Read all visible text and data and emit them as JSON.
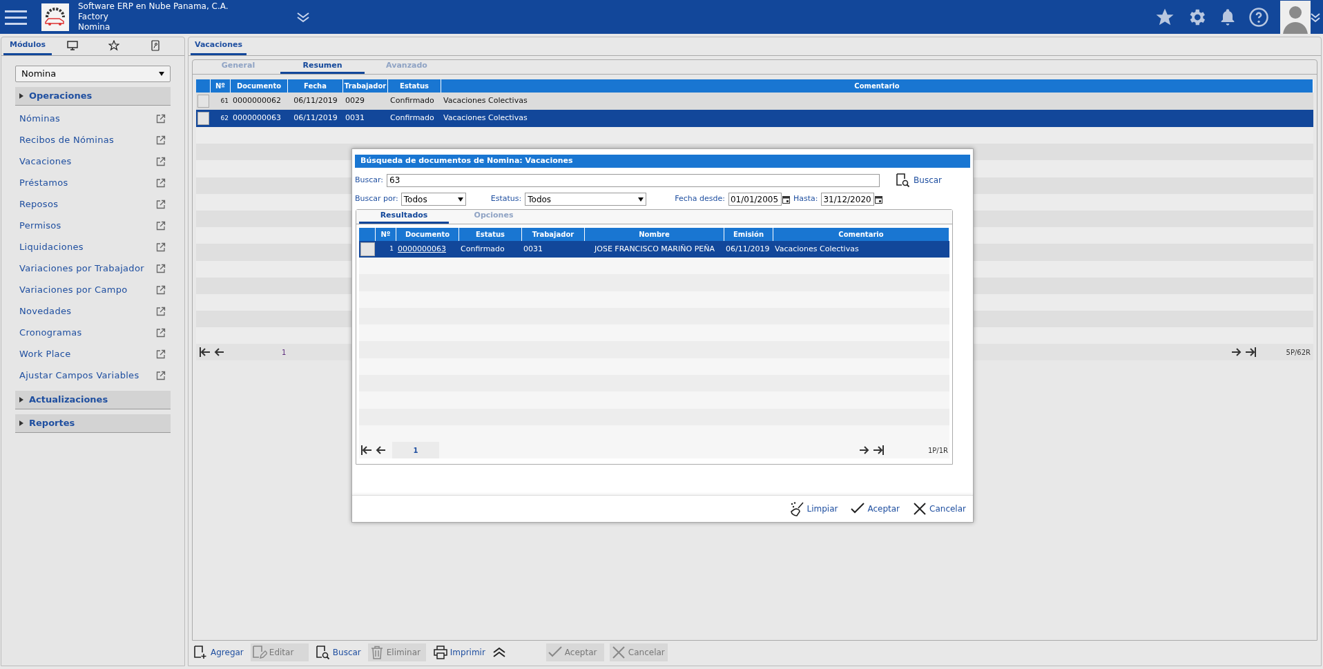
{
  "header": {
    "company": "Software ERP en Nube Panama, C.A.",
    "branch": "Factory",
    "module": "Nomina"
  },
  "sidebar": {
    "tabs": [
      {
        "kind": "text",
        "label": "Módulos",
        "selected": true
      },
      {
        "kind": "monitor",
        "selected": false
      },
      {
        "kind": "star",
        "selected": false
      },
      {
        "kind": "document",
        "selected": false
      }
    ],
    "module_select": "Nomina",
    "sections": [
      {
        "title": "Operaciones",
        "items": [
          "Nóminas",
          "Recibos de Nóminas",
          "Vacaciones",
          "Préstamos",
          "Reposos",
          "Permisos",
          "Liquidaciones",
          "Variaciones por Trabajador",
          "Variaciones por Campo",
          "Novedades",
          "Cronogramas",
          "Work Place",
          "Ajustar Campos Variables"
        ]
      },
      {
        "title": "Actualizaciones"
      },
      {
        "title": "Reportes"
      }
    ]
  },
  "main": {
    "tab": "Vacaciones",
    "subtabs": [
      {
        "label": "General",
        "selected": false
      },
      {
        "label": "Resumen",
        "selected": true
      },
      {
        "label": "Avanzado",
        "selected": false
      }
    ],
    "columns": [
      "Nº",
      "Documento",
      "Fecha",
      "Trabajador",
      "Estatus",
      "Comentario"
    ],
    "rows": [
      {
        "cells": [
          "61",
          "0000000062",
          "06/11/2019",
          "0029",
          "Confirmado",
          "Vacaciones Colectivas"
        ],
        "selected": false
      },
      {
        "cells": [
          "62",
          "0000000063",
          "06/11/2019",
          "0031",
          "Confirmado",
          "Vacaciones Colectivas"
        ],
        "selected": true
      }
    ],
    "pager": {
      "page": "1",
      "summary": "5P/62R"
    }
  },
  "dialog": {
    "title": "Búsqueda de documentos de Nomina: Vacaciones",
    "search_label": "Buscar:",
    "search_value": "63",
    "search_button": "Buscar",
    "search_by_label": "Buscar por:",
    "search_by_value": "Todos",
    "status_label": "Estatus:",
    "status_value": "Todos",
    "date_from_label": "Fecha desde:",
    "date_from_value": "01/01/2005",
    "date_to_label": "Hasta:",
    "date_to_value": "31/12/2020",
    "tabs": [
      {
        "label": "Resultados",
        "selected": true
      },
      {
        "label": "Opciones",
        "selected": false
      }
    ],
    "columns": [
      "Nº",
      "Documento",
      "Estatus",
      "Trabajador",
      "Nombre",
      "Emisión",
      "Comentario"
    ],
    "rows": [
      {
        "cells": [
          "1",
          "0000000063",
          "Confirmado",
          "0031",
          "JOSE FRANCISCO MARIÑO PEÑA",
          "06/11/2019",
          "Vacaciones Colectivas"
        ],
        "selected": true
      }
    ],
    "pager": {
      "page": "1",
      "summary": "1P/1R"
    },
    "buttons": [
      {
        "kind": "clear",
        "label": "Limpiar"
      },
      {
        "kind": "accept",
        "label": "Aceptar"
      },
      {
        "kind": "cancel",
        "label": "Cancelar"
      }
    ]
  },
  "toolbar": [
    {
      "kind": "add",
      "label": "Agregar",
      "disabled": false
    },
    {
      "kind": "edit",
      "label": "Editar",
      "disabled": true
    },
    {
      "kind": "search",
      "label": "Buscar",
      "disabled": false
    },
    {
      "kind": "delete",
      "label": "Eliminar",
      "disabled": true
    },
    {
      "kind": "print",
      "label": "Imprimir",
      "disabled": false
    },
    {
      "kind": "collapse"
    },
    {
      "kind": "accept",
      "label": "Aceptar",
      "disabled": true
    },
    {
      "kind": "cancel",
      "label": "Cancelar",
      "disabled": true
    }
  ]
}
